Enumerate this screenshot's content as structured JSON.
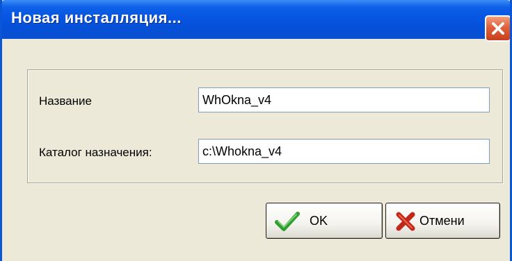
{
  "window": {
    "title": "Новая инсталляция...",
    "close_icon": "close-x-icon"
  },
  "form": {
    "name_label": "Название",
    "name_value": "WhOkna_v4",
    "dest_label": "Каталог назначения:",
    "dest_value": "c:\\Whokna_v4"
  },
  "buttons": {
    "ok_label": "OK",
    "ok_icon": "checkmark-icon",
    "cancel_label": "Отмени",
    "cancel_icon": "cross-icon"
  },
  "colors": {
    "titlebar": "#0655e3",
    "window_bg": "#ece9d8",
    "close_button": "#e0603a",
    "ok_icon": "#2e9e2e",
    "cancel_icon": "#c0281a"
  }
}
